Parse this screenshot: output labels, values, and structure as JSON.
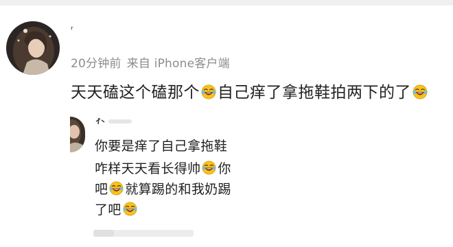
{
  "post": {
    "username_mark": "ʳ",
    "time": "20分钟前",
    "source": "来自 iPhone客户端",
    "comment": {
      "part1": "天天磕这个磕那个",
      "part2": "自己痒了拿拖鞋拍两下的了"
    }
  },
  "reply": {
    "line1": "你要是痒了自己拿拖鞋",
    "line2": "咋样天天看长得帅",
    "line2_tail": "你",
    "line3_a": "吧",
    "line3_b": "就算踢的和我奶踢",
    "line4": "了吧"
  },
  "icons": {
    "avatar": "avatar-portrait",
    "emoji": "laughing-crying-emoji"
  },
  "colors": {
    "meta_text": "#8c8c8c",
    "emoji_face": "#f6c21e"
  }
}
